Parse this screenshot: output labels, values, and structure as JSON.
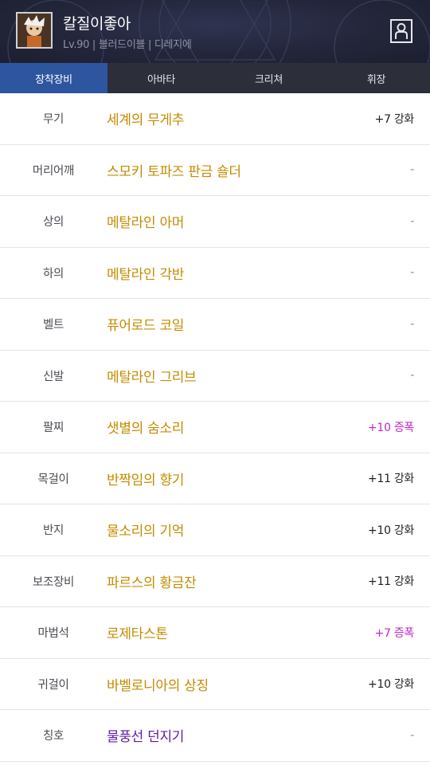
{
  "header": {
    "char_name": "칼질이좋아",
    "char_info": "Lv.90 | 블러드이블 | 디레지에",
    "avatar_icon": "character-portrait-icon",
    "profile_icon": "person-icon"
  },
  "tabs": [
    {
      "label": "장착장비",
      "active": true
    },
    {
      "label": "아바타",
      "active": false
    },
    {
      "label": "크리쳐",
      "active": false
    },
    {
      "label": "휘장",
      "active": false
    }
  ],
  "equipment": [
    {
      "slot": "무기",
      "item": "세계의 무게추",
      "enhance": "+7 강화",
      "enhance_type": "reinforce",
      "color": "#c48b00"
    },
    {
      "slot": "머리어깨",
      "item": "스모키 토파즈 판금 숄더",
      "enhance": "-",
      "enhance_type": "none",
      "color": "#c48b00"
    },
    {
      "slot": "상의",
      "item": "메탈라인 아머",
      "enhance": "-",
      "enhance_type": "none",
      "color": "#c48b00"
    },
    {
      "slot": "하의",
      "item": "메탈라인 각반",
      "enhance": "-",
      "enhance_type": "none",
      "color": "#c48b00"
    },
    {
      "slot": "벨트",
      "item": "퓨어로드 코일",
      "enhance": "-",
      "enhance_type": "none",
      "color": "#c48b00"
    },
    {
      "slot": "신발",
      "item": "메탈라인 그리브",
      "enhance": "-",
      "enhance_type": "none",
      "color": "#c48b00"
    },
    {
      "slot": "팔찌",
      "item": "샛별의 숨소리",
      "enhance": "+10 증폭",
      "enhance_type": "amplify",
      "color": "#c48b00"
    },
    {
      "slot": "목걸이",
      "item": "반짝임의 향기",
      "enhance": "+11 강화",
      "enhance_type": "reinforce",
      "color": "#c48b00"
    },
    {
      "slot": "반지",
      "item": "물소리의 기억",
      "enhance": "+10 강화",
      "enhance_type": "reinforce",
      "color": "#c48b00"
    },
    {
      "slot": "보조장비",
      "item": "파르스의 황금잔",
      "enhance": "+11 강화",
      "enhance_type": "reinforce",
      "color": "#c48b00"
    },
    {
      "slot": "마법석",
      "item": "로제타스톤",
      "enhance": "+7 증폭",
      "enhance_type": "amplify",
      "color": "#c48b00"
    },
    {
      "slot": "귀걸이",
      "item": "바벨로니아의 상징",
      "enhance": "+10 강화",
      "enhance_type": "reinforce",
      "color": "#c48b00"
    },
    {
      "slot": "칭호",
      "item": "물풍선 던지기",
      "enhance": "-",
      "enhance_type": "none",
      "color": "#5b1ca8"
    }
  ],
  "colors": {
    "header_bg": "#23263a",
    "tab_bar_bg": "#2c2e3a",
    "tab_active_bg": "#2d55a0",
    "epic_item": "#c48b00",
    "rare_item": "#5b1ca8",
    "amplify_text": "#c227c9"
  }
}
